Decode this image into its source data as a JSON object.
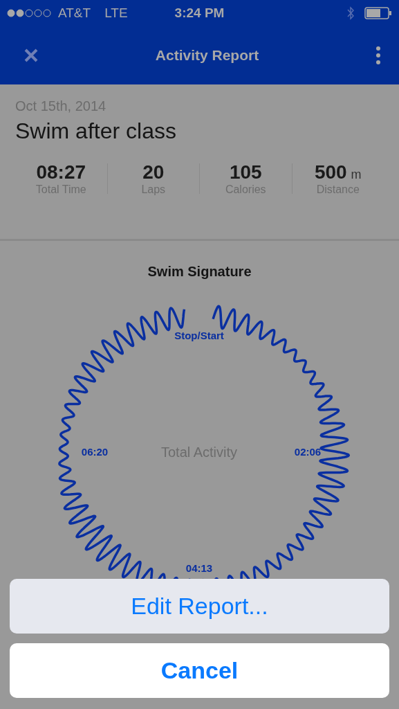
{
  "status_bar": {
    "carrier": "AT&T",
    "network": "LTE",
    "time": "3:24 PM"
  },
  "nav": {
    "title": "Activity Report"
  },
  "activity": {
    "date": "Oct 15th, 2014",
    "name": "Swim after class"
  },
  "stats": [
    {
      "value": "08:27",
      "label": "Total Time"
    },
    {
      "value": "20",
      "label": "Laps"
    },
    {
      "value": "105",
      "label": "Calories"
    },
    {
      "value": "500",
      "unit": "m",
      "label": "Distance"
    }
  ],
  "signature": {
    "title": "Swim Signature",
    "center_label": "Total Activity",
    "top_label": "Stop/Start",
    "right_label": "02:06",
    "bottom_label": "04:13",
    "left_label": "06:20"
  },
  "action_sheet": {
    "actions": [
      "Edit Report..."
    ],
    "cancel": "Cancel"
  }
}
